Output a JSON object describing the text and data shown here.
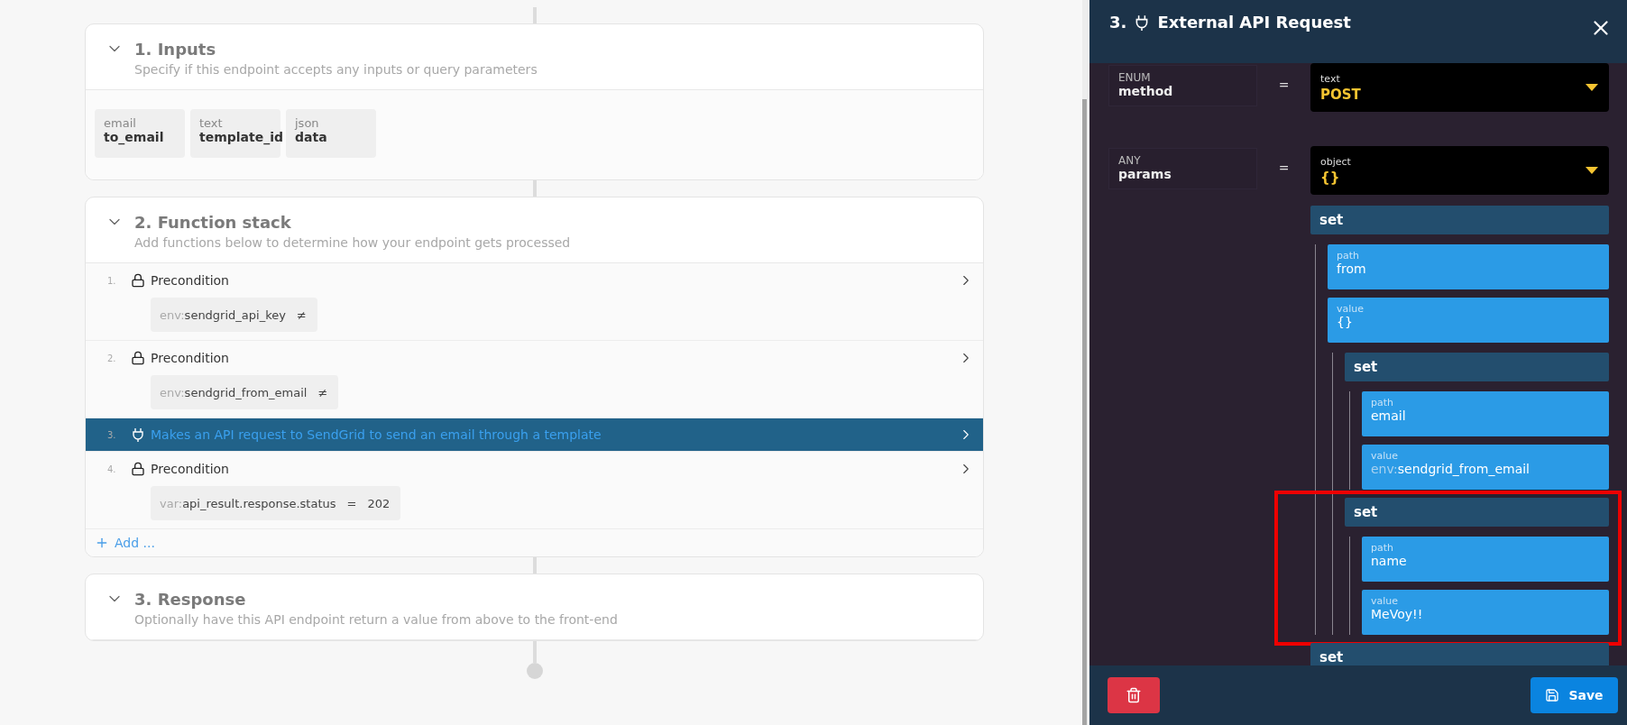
{
  "sections": [
    {
      "kind": "inputs",
      "number": "1.",
      "title": "Inputs",
      "subtitle": "Specify if this endpoint accepts any inputs or query parameters",
      "expanded": true,
      "inputs": [
        {
          "type": "email",
          "name": "to_email"
        },
        {
          "type": "text",
          "name": "template_id"
        },
        {
          "type": "json",
          "name": "data"
        }
      ]
    },
    {
      "kind": "functions",
      "number": "2.",
      "title": "Function stack",
      "subtitle": "Add functions below to determine how your endpoint gets processed",
      "expanded": true,
      "functions": [
        {
          "number": "1.",
          "kind": "precondition",
          "title": "Precondition",
          "selected": false,
          "condition": {
            "prefix": "env:",
            "value": "sendgrid_api_key",
            "operator": "≠"
          }
        },
        {
          "number": "2.",
          "kind": "precondition",
          "title": "Precondition",
          "selected": false,
          "condition": {
            "prefix": "env:",
            "value": "sendgrid_from_email",
            "operator": "≠"
          }
        },
        {
          "number": "3.",
          "kind": "request",
          "title": "Makes an API request to SendGrid to send an email through a template",
          "selected": true
        },
        {
          "number": "4.",
          "kind": "precondition",
          "title": "Precondition",
          "selected": false,
          "condition": {
            "prefix": "var:",
            "value": "api_result.response.status",
            "operator": "=",
            "operand": "202"
          }
        }
      ],
      "add_label": "Add ..."
    },
    {
      "kind": "response",
      "number": "3.",
      "title": "Response",
      "subtitle": "Optionally have this API endpoint return a value from above to the front-end",
      "expanded": true
    }
  ],
  "panel": {
    "number": "3.",
    "title": "External API Request",
    "params": [
      {
        "type": "ENUM",
        "name": "method",
        "operator": "=",
        "value_type": "text",
        "value": "POST"
      },
      {
        "type": "ANY",
        "name": "params",
        "operator": "=",
        "value_type": "object",
        "value": "{}",
        "children": [
          {
            "kind": "set",
            "label": "set",
            "children": [
              {
                "kind": "field",
                "label": "path",
                "value": "from"
              },
              {
                "kind": "field",
                "label": "value",
                "value": "{}",
                "children": [
                  {
                    "kind": "set",
                    "label": "set",
                    "children": [
                      {
                        "kind": "field",
                        "label": "path",
                        "value": "email"
                      },
                      {
                        "kind": "field",
                        "label": "value",
                        "prefix": "env:",
                        "value": "sendgrid_from_email"
                      }
                    ]
                  },
                  {
                    "kind": "set",
                    "label": "set",
                    "highlighted": true,
                    "children": [
                      {
                        "kind": "field",
                        "label": "path",
                        "value": "name"
                      },
                      {
                        "kind": "field",
                        "label": "value",
                        "value": "MeVoy!!"
                      }
                    ]
                  }
                ]
              }
            ]
          },
          {
            "kind": "set",
            "label": "set"
          }
        ]
      }
    ],
    "save_label": "Save"
  }
}
